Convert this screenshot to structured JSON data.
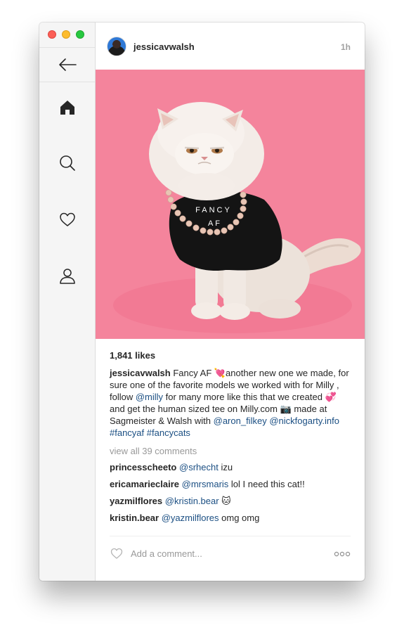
{
  "window": {
    "controls": [
      "close",
      "minimize",
      "zoom"
    ]
  },
  "sidebar": {
    "icons": [
      "back-arrow-icon",
      "home-icon",
      "search-icon",
      "heart-icon",
      "profile-icon"
    ]
  },
  "post": {
    "username": "jessicavwalsh",
    "time": "1h",
    "likes": "1,841 likes",
    "caption": {
      "username": "jessicavwalsh",
      "part1": " Fancy AF 💘another new one we made, for sure one of the favorite models we worked with for Milly , follow ",
      "mention1": "@milly",
      "part2": " for many more like this that we created 💞and get the human sized tee on Milly.com 📷 made at Sagmeister & Walsh with ",
      "mention2": "@aron_filkey",
      "part3": " ",
      "mention3": "@nickfogarty.info",
      "part4": " ",
      "hashtag1": "#fancyaf",
      "part5": " ",
      "hashtag2": "#fancycats"
    },
    "shirt_text_line1": "FANCY",
    "shirt_text_line2": "AF",
    "view_all_comments": "view all 39 comments",
    "comments": [
      {
        "user": "princesscheeto",
        "mention": "@srhecht",
        "text": " izu"
      },
      {
        "user": "ericamarieclaire",
        "mention": "@mrsmaris",
        "text": " lol I need this cat!!"
      },
      {
        "user": "yazmilflores",
        "mention": "@kristin.bear",
        "text": " 🐱"
      },
      {
        "user": "kristin.bear",
        "mention": "@yazmilflores",
        "text": " omg omg"
      }
    ],
    "add_comment_placeholder": "Add a comment..."
  },
  "colors": {
    "photo_background": "#f4849c",
    "link": "#1b4f83",
    "muted": "#999999"
  }
}
